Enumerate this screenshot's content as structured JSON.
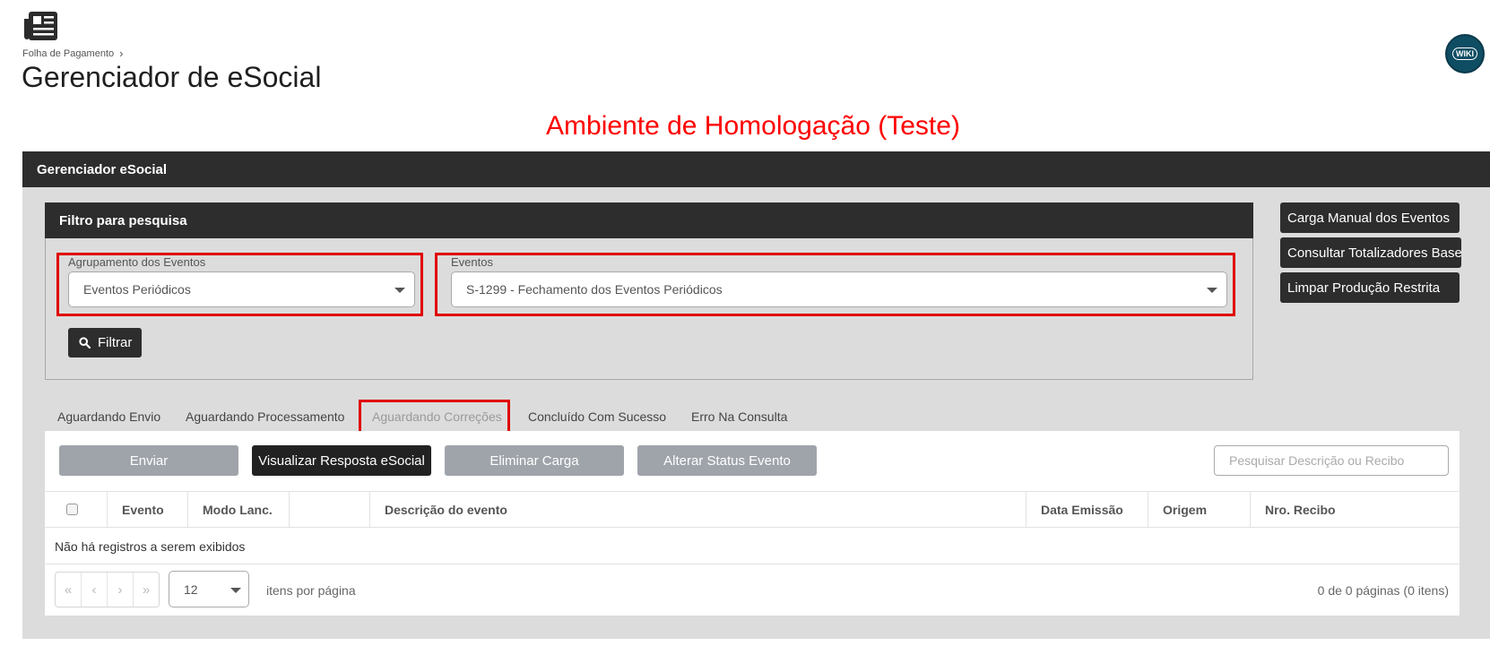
{
  "breadcrumb": {
    "parent": "Folha de Pagamento",
    "separator": "›"
  },
  "page_title": "Gerenciador de eSocial",
  "wiki_label": "WIKI",
  "environment_banner": "Ambiente de Homologação (Teste)",
  "panel": {
    "title": "Gerenciador eSocial"
  },
  "filter": {
    "title": "Filtro para pesquisa",
    "grouping": {
      "label": "Agrupamento dos Eventos",
      "value": "Eventos Periódicos"
    },
    "events": {
      "label": "Eventos",
      "value": "S-1299 - Fechamento dos Eventos Periódicos"
    },
    "filter_button": "Filtrar"
  },
  "side_buttons": {
    "manual_load": "Carga Manual dos Eventos",
    "totalizers": "Consultar Totalizadores Base",
    "clear_restricted": "Limpar Produção Restrita"
  },
  "tabs": [
    {
      "label": "Aguardando Envio"
    },
    {
      "label": "Aguardando Processamento"
    },
    {
      "label": "Aguardando Correções",
      "active": true
    },
    {
      "label": "Concluído Com Sucesso"
    },
    {
      "label": "Erro Na Consulta"
    }
  ],
  "actions": {
    "send": "Enviar",
    "view_response": "Visualizar Resposta eSocial",
    "delete_load": "Eliminar Carga",
    "change_status": "Alterar Status Evento",
    "search_placeholder": "Pesquisar Descrição ou Recibo"
  },
  "grid": {
    "columns": [
      "Evento",
      "Modo Lanc.",
      "",
      "Descrição do evento",
      "Data Emissão",
      "Origem",
      "Nro. Recibo"
    ],
    "empty_message": "Não há registros a serem exibidos"
  },
  "pagination": {
    "first": "«",
    "prev": "‹",
    "next": "›",
    "last": "»",
    "page_size": "12",
    "per_page_label": "itens por página",
    "info": "0 de 0 páginas (0 itens)"
  },
  "colors": {
    "highlight": "#ff0000",
    "header_bg": "#2d2d2d",
    "panel_bg": "#dcdcdc",
    "wiki_bg": "#0f4d63"
  }
}
